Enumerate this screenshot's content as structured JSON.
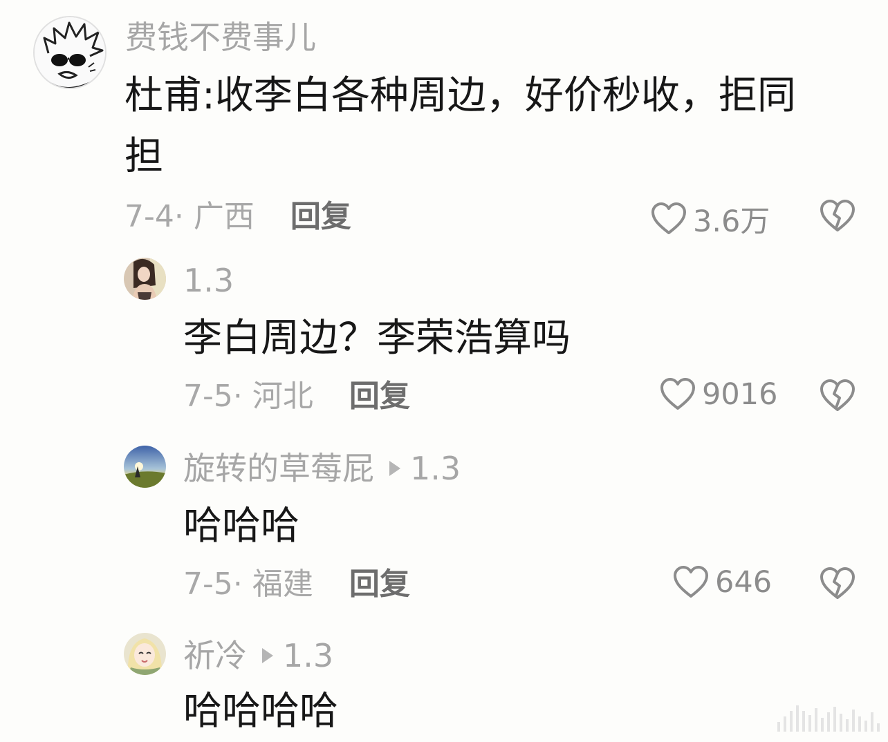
{
  "comments": [
    {
      "username": "费钱不费事儿",
      "text_line1": "杜甫:收李白各种周边，好价秒收，拒同",
      "text_line2": "担",
      "date_location": "7-4· 广西",
      "reply": "回复",
      "likes": "3.6万",
      "avatar_icon": "manga-boy-avatar"
    },
    {
      "username": "1.3",
      "text": "李白周边？李荣浩算吗",
      "date_location": "7-5· 河北",
      "reply": "回复",
      "likes": "9016",
      "avatar_icon": "girl-photo-avatar"
    },
    {
      "username": "旋转的草莓屁",
      "reply_to": "1.3",
      "text": "哈哈哈",
      "date_location": "7-5· 福建",
      "reply": "回复",
      "likes": "646",
      "avatar_icon": "landscape-avatar"
    },
    {
      "username": "祈冷",
      "reply_to": "1.3",
      "text": "哈哈哈哈",
      "avatar_icon": "anime-girl-avatar"
    }
  ],
  "colors": {
    "background": "#fdfdfb",
    "username": "#a6a6a6",
    "text": "#171717",
    "reply": "#6d6d6d"
  }
}
